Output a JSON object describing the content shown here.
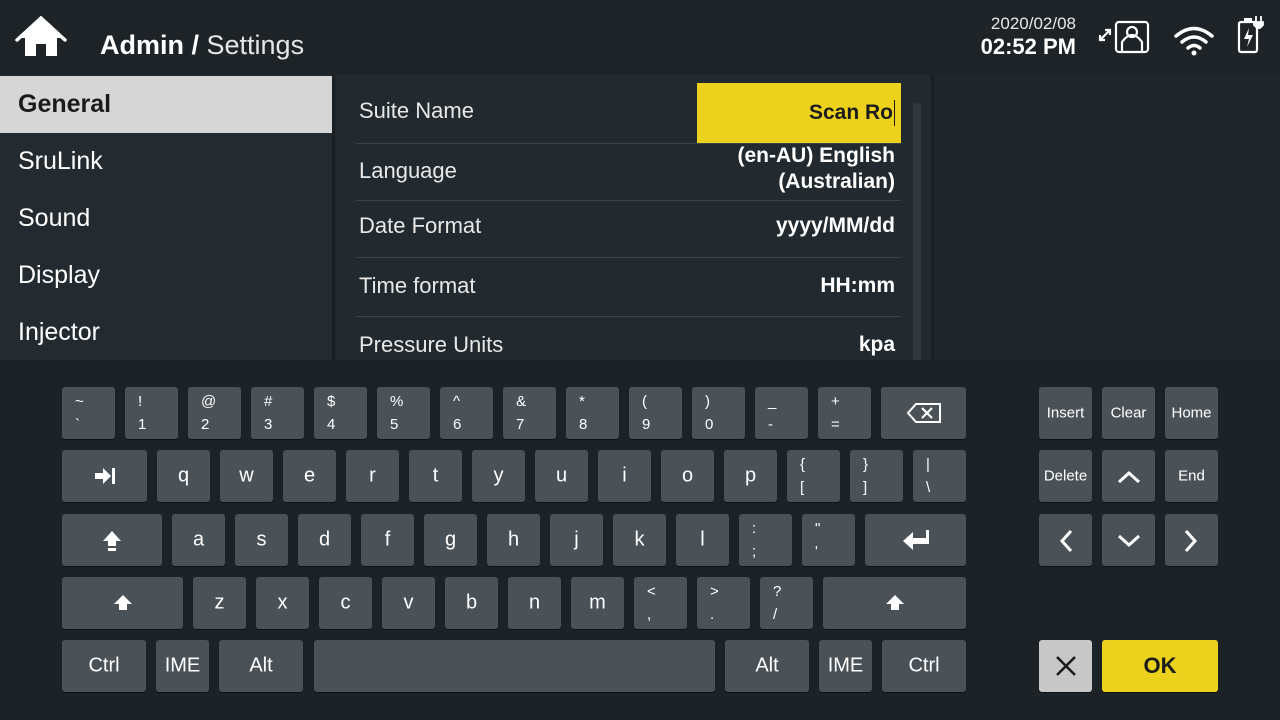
{
  "header": {
    "breadcrumb_root": "Admin /",
    "breadcrumb_page": "Settings",
    "date": "2020/02/08",
    "time": "02:52 PM"
  },
  "sidebar": {
    "items": [
      {
        "label": "General",
        "active": true
      },
      {
        "label": "SruLink"
      },
      {
        "label": "Sound"
      },
      {
        "label": "Display"
      },
      {
        "label": "Injector"
      }
    ]
  },
  "settings": {
    "suite_name_label": "Suite Name",
    "suite_name_value": "Scan Ro",
    "language_label": "Language",
    "language_value_line1": "(en-AU) English",
    "language_value_line2": "(Australian)",
    "date_format_label": "Date Format",
    "date_format_value": "yyyy/MM/dd",
    "time_format_label": "Time format",
    "time_format_value": "HH:mm",
    "pressure_units_label": "Pressure Units",
    "pressure_units_value": "kpa"
  },
  "keyboard": {
    "row1": [
      {
        "top": "~",
        "bottom": "`"
      },
      {
        "top": "!",
        "bottom": "1"
      },
      {
        "top": "@",
        "bottom": "2"
      },
      {
        "top": "#",
        "bottom": "3"
      },
      {
        "top": "$",
        "bottom": "4"
      },
      {
        "top": "%",
        "bottom": "5"
      },
      {
        "top": "^",
        "bottom": "6"
      },
      {
        "top": "&",
        "bottom": "7"
      },
      {
        "top": "*",
        "bottom": "8"
      },
      {
        "top": "(",
        "bottom": "9"
      },
      {
        "top": ")",
        "bottom": "0"
      },
      {
        "top": "_",
        "bottom": "-"
      },
      {
        "top": "+",
        "bottom": "="
      }
    ],
    "row2": [
      "q",
      "w",
      "e",
      "r",
      "t",
      "y",
      "u",
      "i",
      "o",
      "p"
    ],
    "row2_dual": [
      {
        "top": "{",
        "bottom": "["
      },
      {
        "top": "}",
        "bottom": "]"
      },
      {
        "top": "|",
        "bottom": "\\"
      }
    ],
    "row3": [
      "a",
      "s",
      "d",
      "f",
      "g",
      "h",
      "j",
      "k",
      "l"
    ],
    "row3_dual": [
      {
        "top": ":",
        "bottom": ";"
      },
      {
        "top": "\"",
        "bottom": "'"
      }
    ],
    "row4": [
      "z",
      "x",
      "c",
      "v",
      "b",
      "n",
      "m"
    ],
    "row4_dual": [
      {
        "top": "<",
        "bottom": ","
      },
      {
        "top": ">",
        "bottom": "."
      },
      {
        "top": "?",
        "bottom": "/"
      }
    ],
    "ctrl_left": "Ctrl",
    "ime_left": "IME",
    "alt_left": "Alt",
    "alt_right": "Alt",
    "ime_right": "IME",
    "ctrl_right": "Ctrl",
    "insert": "Insert",
    "clear": "Clear",
    "home": "Home",
    "delete": "Delete",
    "end": "End",
    "ok": "OK"
  },
  "colors": {
    "accent_yellow": "#ecd21c",
    "key_gray": "#4a5258",
    "background": "#1a1f23"
  },
  "icons": {
    "home": "home-icon",
    "remote": "remote-connection-icon",
    "wifi": "wifi-icon",
    "battery": "battery-charging-icon",
    "backspace": "backspace-icon",
    "tab": "tab-icon",
    "enter": "enter-icon",
    "shift": "shift-icon"
  }
}
